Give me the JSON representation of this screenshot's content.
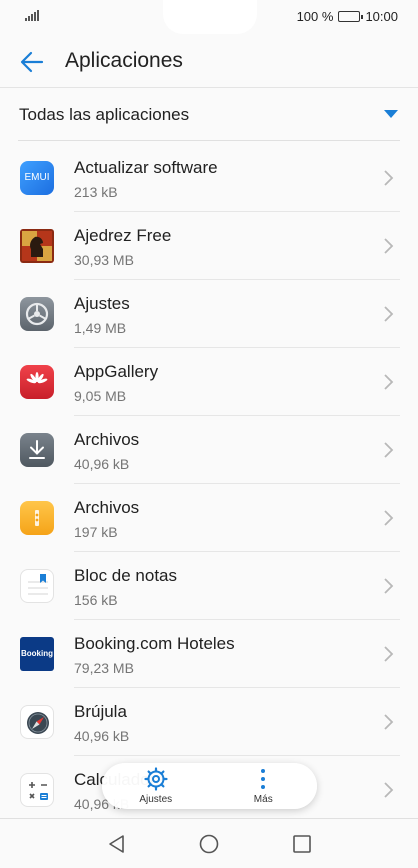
{
  "status_bar": {
    "battery_percent": "100 %",
    "time": "10:00"
  },
  "header": {
    "title": "Aplicaciones",
    "back_icon": "arrow-left-icon"
  },
  "filter": {
    "label": "Todas las aplicaciones",
    "icon": "dropdown-triangle-icon",
    "accent": "#1a7ed6"
  },
  "apps": [
    {
      "name": "Actualizar software",
      "size": "213 kB",
      "icon": "emui-icon"
    },
    {
      "name": "Ajedrez Free",
      "size": "30,93 MB",
      "icon": "chess-icon"
    },
    {
      "name": "Ajustes",
      "size": "1,49 MB",
      "icon": "settings-icon"
    },
    {
      "name": "AppGallery",
      "size": "9,05 MB",
      "icon": "appgallery-icon"
    },
    {
      "name": "Archivos",
      "size": "40,96 kB",
      "icon": "download-icon"
    },
    {
      "name": "Archivos",
      "size": "197 kB",
      "icon": "files-icon"
    },
    {
      "name": "Bloc de notas",
      "size": "156 kB",
      "icon": "notepad-icon"
    },
    {
      "name": "Booking.com Hoteles",
      "size": "79,23 MB",
      "icon": "booking-icon"
    },
    {
      "name": "Brújula",
      "size": "40,96 kB",
      "icon": "compass-icon"
    },
    {
      "name": "Calculadora",
      "size": "40,96 kB",
      "icon": "calculator-icon"
    }
  ],
  "icon_text": {
    "emui": "EMUI",
    "booking": "Booking"
  },
  "bottom_actions": {
    "settings_label": "Ajustes",
    "more_label": "Más"
  },
  "nav": {
    "back": "triangle-back-icon",
    "home": "circle-home-icon",
    "recents": "square-recents-icon"
  }
}
